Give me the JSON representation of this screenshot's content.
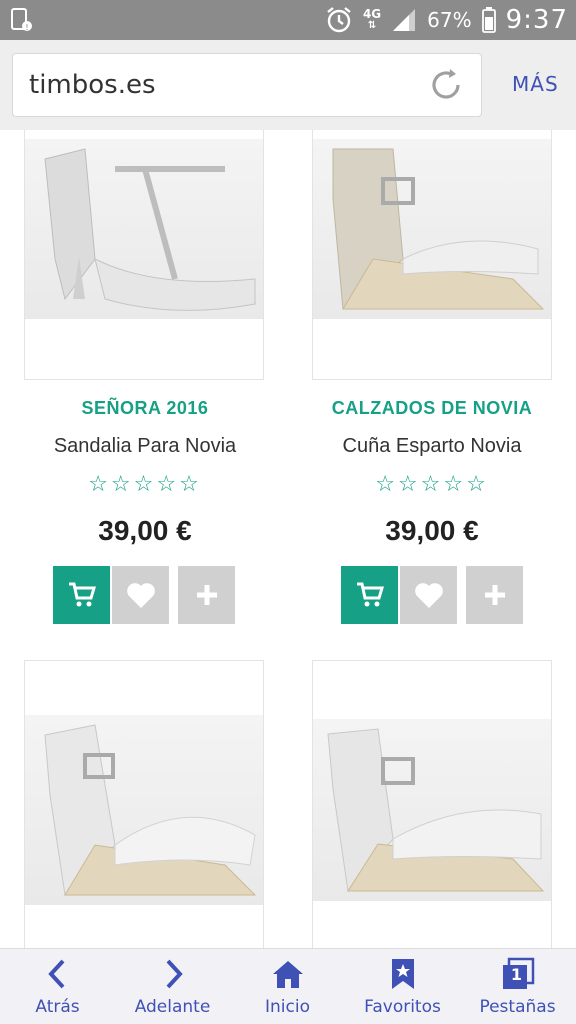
{
  "status_bar": {
    "network": "4G",
    "battery": "67%",
    "time": "9:37"
  },
  "browser": {
    "url": "timbos.es",
    "more_label": "MÁS"
  },
  "products": [
    {
      "category": "SEÑORA 2016",
      "name": "Sandalia Para Novia",
      "rating": "☆☆☆☆☆",
      "price": "39,00 €"
    },
    {
      "category": "CALZADOS DE NOVIA",
      "name": "Cuña Esparto Novia",
      "rating": "☆☆☆☆☆",
      "price": "39,00 €"
    },
    {
      "category": "",
      "name": "",
      "rating": "",
      "price": ""
    },
    {
      "category": "",
      "name": "",
      "rating": "",
      "price": ""
    }
  ],
  "bottom_nav": {
    "back": "Atrás",
    "forward": "Adelante",
    "home": "Inicio",
    "favorites": "Favoritos",
    "tabs": "Pestañas",
    "tab_count": "1"
  },
  "colors": {
    "accent_green": "#16a085",
    "nav_blue": "#3f51b5",
    "status_bar": "#8b8b8b"
  }
}
